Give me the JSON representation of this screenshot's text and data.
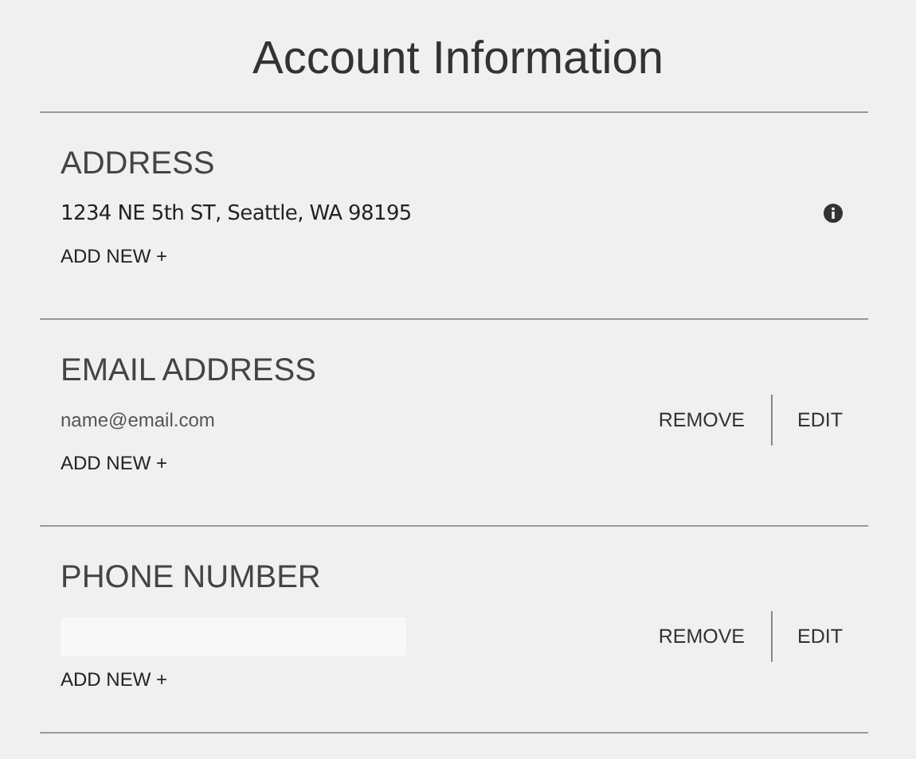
{
  "title": "Account Information",
  "sections": [
    {
      "heading": "ADDRESS",
      "entry": {
        "kind": "text",
        "value": "1234 NE 5th ST, Seattle, WA 98195",
        "info": true
      },
      "add_label": "ADD NEW +"
    },
    {
      "heading": "EMAIL ADDRESS",
      "entry": {
        "kind": "small",
        "value": "name@email.com",
        "actions": [
          "REMOVE",
          "EDIT"
        ]
      },
      "add_label": "ADD NEW +"
    },
    {
      "heading": "PHONE NUMBER",
      "entry": {
        "kind": "field",
        "actions": [
          "REMOVE",
          "EDIT"
        ]
      },
      "add_label": "ADD NEW +"
    }
  ]
}
